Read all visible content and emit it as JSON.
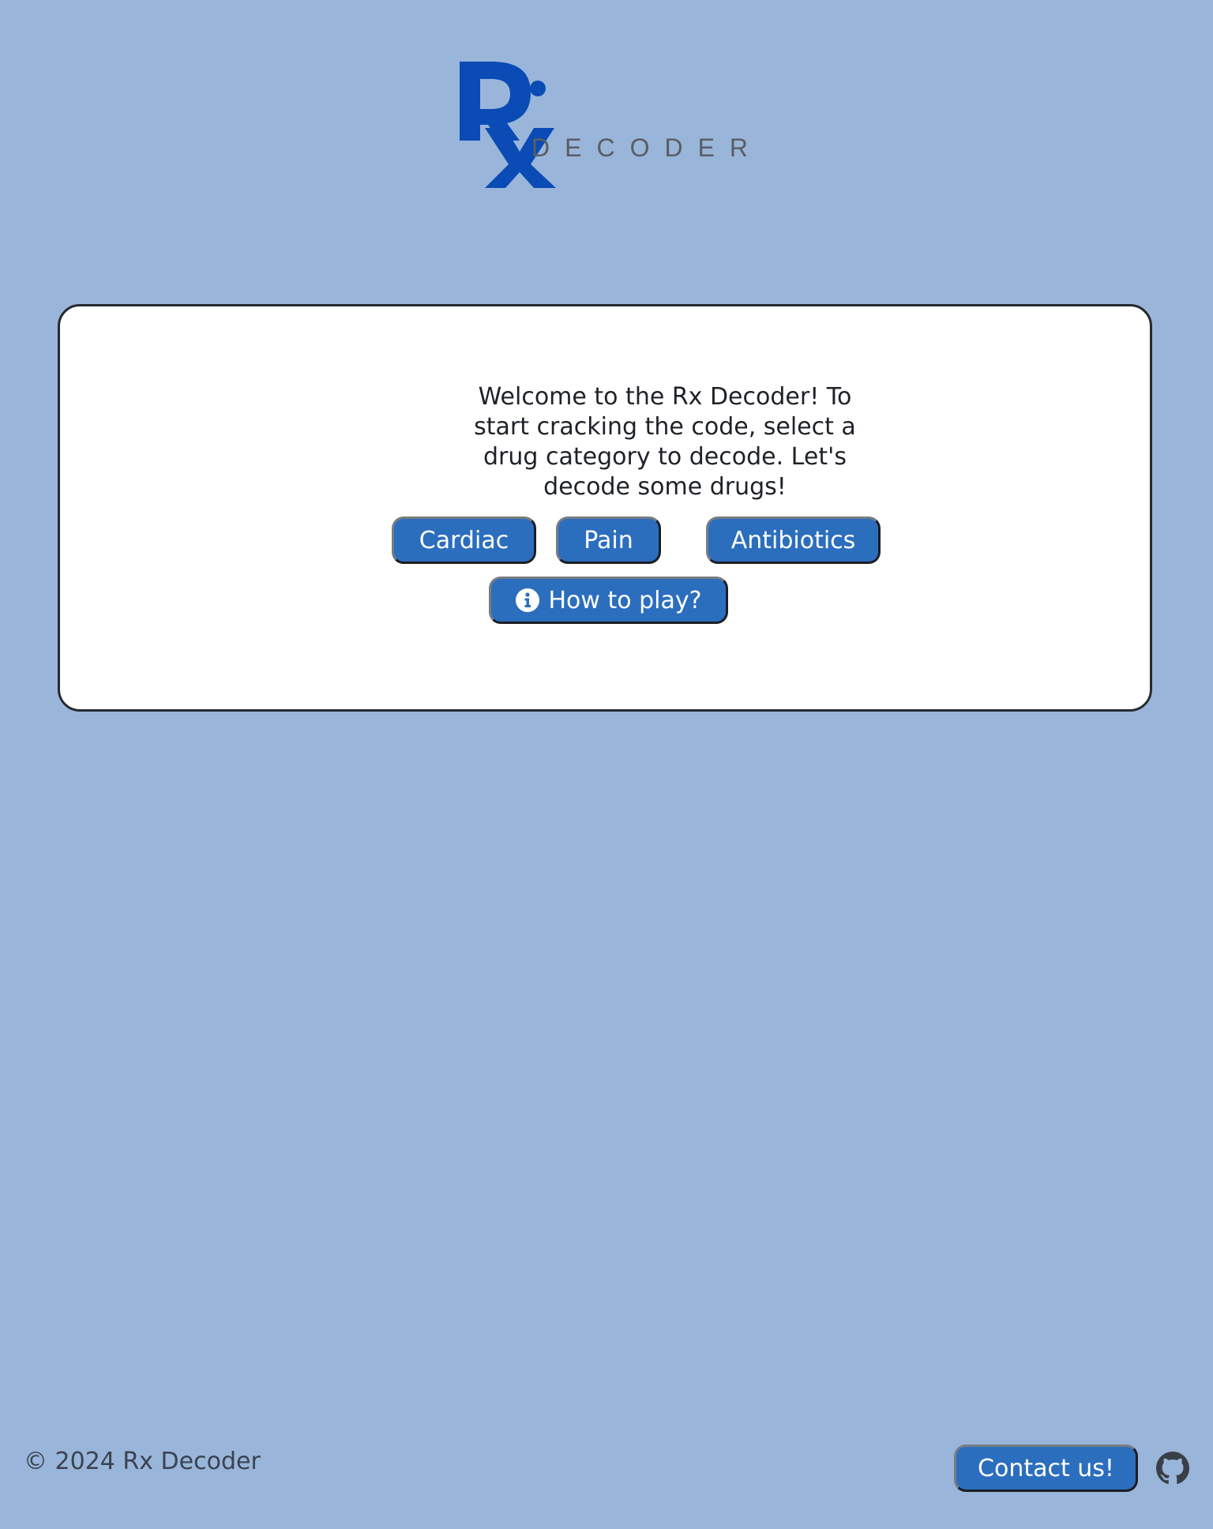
{
  "logo": {
    "mark": "Rx",
    "wordmark": "DECODER",
    "brand_color": "#0a4bb5",
    "wordmark_color": "#5a5d63"
  },
  "card": {
    "welcome_text": "Welcome to the Rx Decoder! To start cracking the code, select a drug category to decode. Let's decode some drugs!"
  },
  "categories": {
    "cardiac": "Cardiac",
    "pain": "Pain",
    "antibiotics": "Antibiotics"
  },
  "how_to_play": {
    "label": "How to play?",
    "icon": "info-circle-icon"
  },
  "footer": {
    "copyright": "© 2024 Rx Decoder",
    "contact_label": "Contact us!",
    "github_icon": "github-icon"
  },
  "colors": {
    "background": "#99b5da",
    "button": "#2c6ebe",
    "card": "#ffffff",
    "text": "#1e2228"
  }
}
